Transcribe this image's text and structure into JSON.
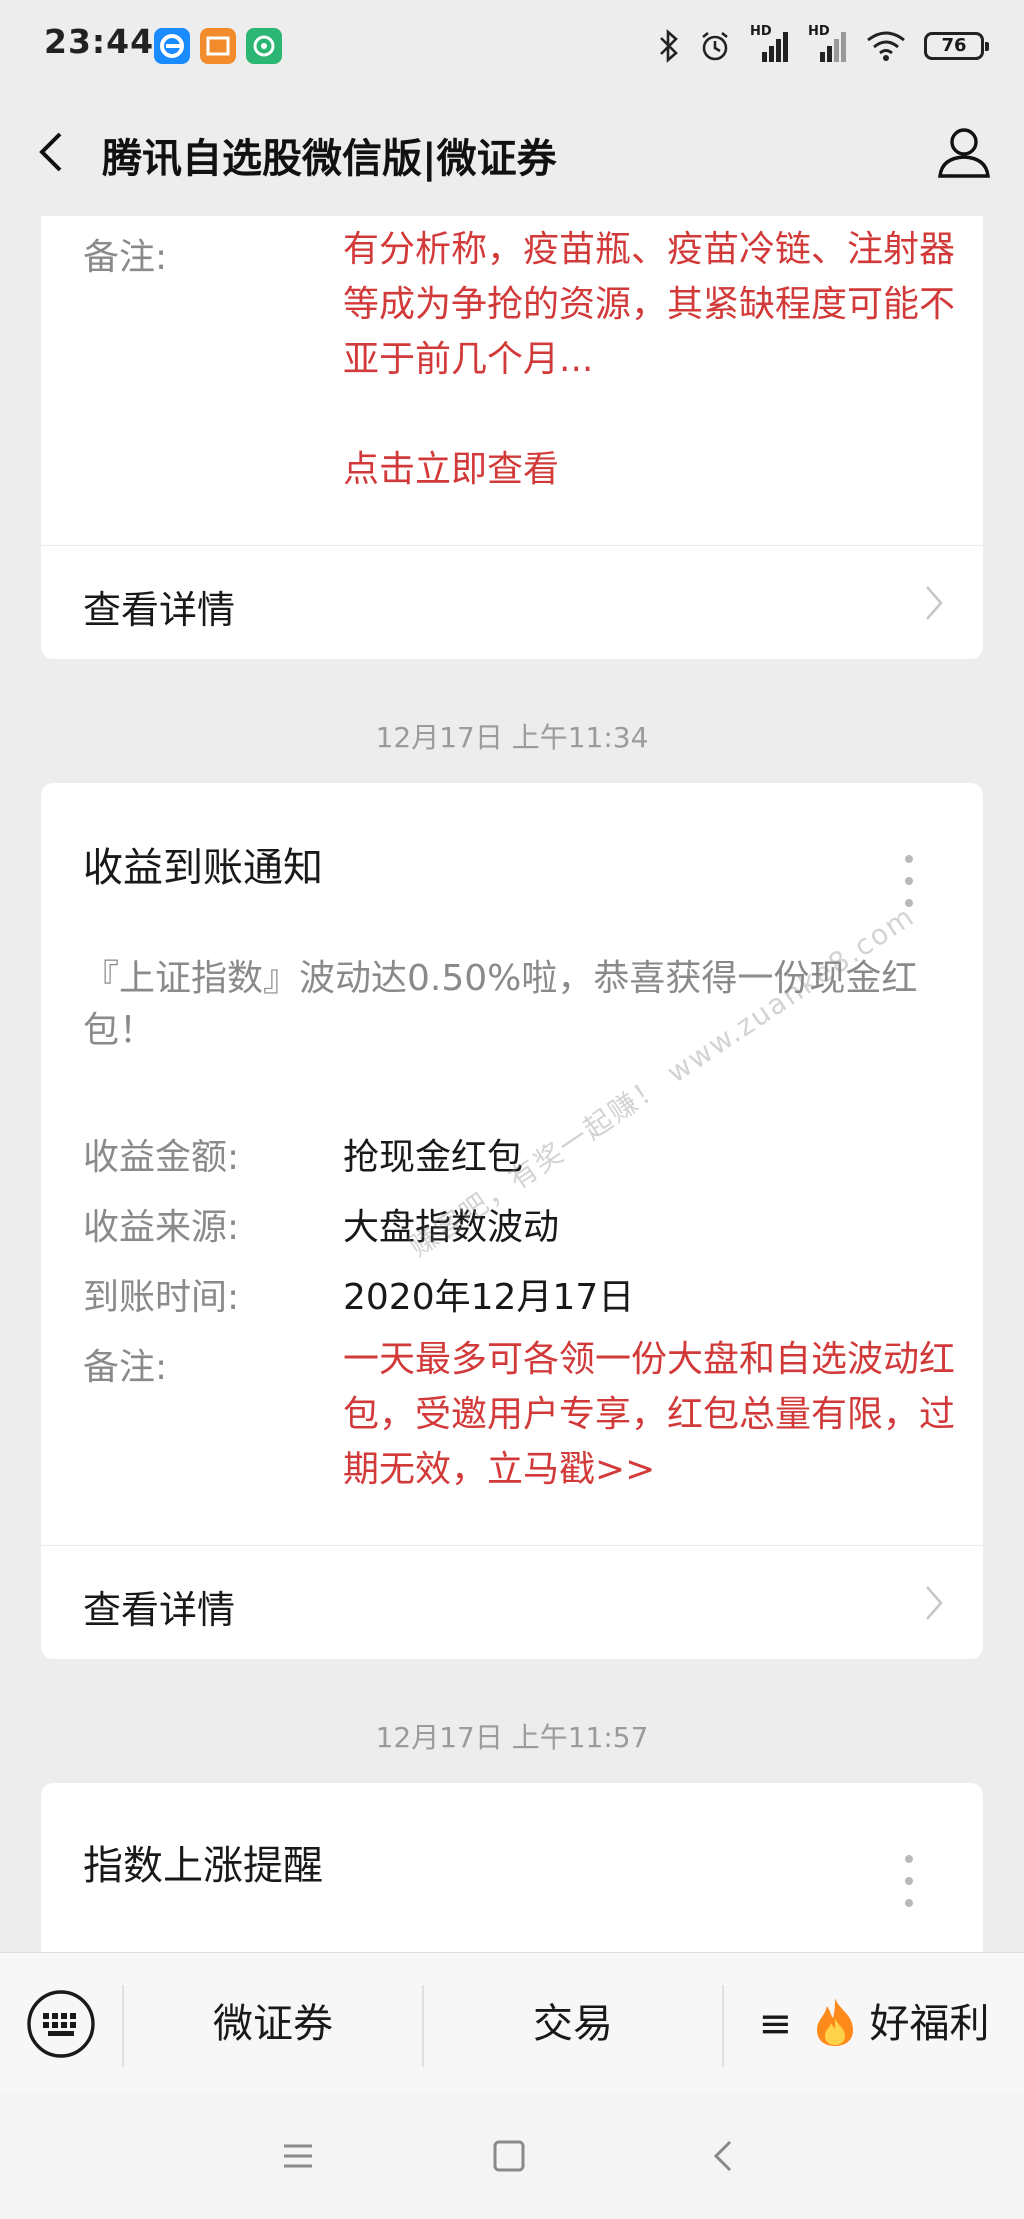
{
  "status_bar": {
    "time": "23:44",
    "battery": "76",
    "signal_1_label": "HD",
    "signal_2_label": "HD"
  },
  "nav": {
    "title": "腾讯自选股微信版|微证券"
  },
  "card1": {
    "remark_label": "备注:",
    "remark_text": "有分析称，疫苗瓶、疫苗冷链、注射器等成为争抢的资源，其紧缺程度可能不亚于前几个月...",
    "remark_link": "点击立即查看",
    "detail_label": "查看详情"
  },
  "timestamp1": "12月17日 上午11:34",
  "card2": {
    "title": "收益到账通知",
    "intro": "『上证指数』波动达0.50%啦，恭喜获得一份现金红包！",
    "fields": [
      {
        "label": "收益金额:",
        "value": "抢现金红包"
      },
      {
        "label": "收益来源:",
        "value": "大盘指数波动"
      },
      {
        "label": "到账时间:",
        "value": "2020年12月17日"
      }
    ],
    "remark_label": "备注:",
    "remark_text": "一天最多可各领一份大盘和自选波动红包，受邀用户专享，红包总量有限，过期无效，立马戳>>",
    "detail_label": "查看详情"
  },
  "timestamp2": "12月17日 上午11:57",
  "card3": {
    "title": "指数上涨提醒"
  },
  "bottom_menu": {
    "item1": "微证券",
    "item2": "交易",
    "item3_prefix": "≡",
    "item3": "好福利"
  },
  "watermark": "赚客吧，有奖一起赚！ www.zuanke8.com",
  "colors": {
    "remark_red": "#d23a3a",
    "background": "#ededed"
  },
  "icons": [
    "back-arrow-icon",
    "profile-icon",
    "more-vertical-icon",
    "chevron-right-icon",
    "keyboard-icon",
    "fire-icon",
    "menu-lines-icon",
    "square-home-icon",
    "back-triangle-icon",
    "bluetooth-icon",
    "alarm-icon",
    "signal-icon",
    "wifi-icon",
    "battery-icon"
  ]
}
